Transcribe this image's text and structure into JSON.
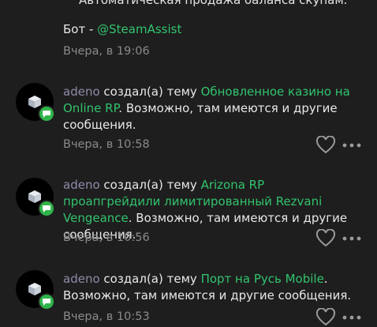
{
  "top": {
    "cut_text": "Автоматическая продажа баланса скупам.",
    "bot_label": "Бот - ",
    "bot_link": "@SteamAssist",
    "time": "Вчера, в 19:06"
  },
  "notifications": [
    {
      "author": "adeno",
      "action": " создал(а) тему ",
      "topic": "Обновленное казино на Online RP",
      "suffix": ". Возможно, там имеются и другие сообщения.",
      "time": "Вчера, в 10:58"
    },
    {
      "author": "adeno",
      "action": " создал(а) тему ",
      "topic": "Arizona RP проапгрейдили лимитированный Rezvani Vengeance",
      "suffix": ". Возможно, там имеются и другие сообщения.",
      "time": "Вчера, в 10:56"
    },
    {
      "author": "adeno",
      "action": " создал(а) тему ",
      "topic": "Порт на Русь Mobile",
      "suffix": ". Возможно, там имеются и другие сообщения.",
      "time": "Вчера, в 10:53"
    }
  ],
  "icons": {
    "badge": "chat-bubble-icon",
    "like": "heart-icon",
    "more": "more-dots-icon",
    "avatar": "cube-icon"
  },
  "colors": {
    "background": "#1e1e1e",
    "link": "#32c36d",
    "author": "#8e8ba8",
    "meta": "#8b8b8b",
    "badge": "#2fb44a"
  }
}
